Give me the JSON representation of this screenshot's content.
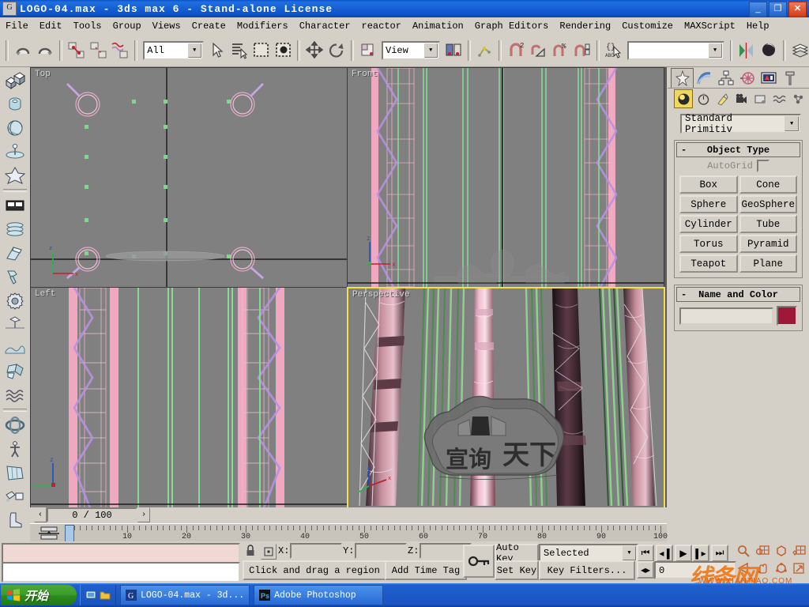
{
  "window": {
    "title": "LOGO-04.max - 3ds max 6 - Stand-alone License",
    "minimize_label": "_",
    "maximize_label": "❐",
    "close_label": "✕"
  },
  "menubar": {
    "items": [
      {
        "label": "File"
      },
      {
        "label": "Edit"
      },
      {
        "label": "Tools"
      },
      {
        "label": "Group"
      },
      {
        "label": "Views"
      },
      {
        "label": "Create"
      },
      {
        "label": "Modifiers"
      },
      {
        "label": "Character"
      },
      {
        "label": "reactor"
      },
      {
        "label": "Animation"
      },
      {
        "label": "Graph Editors"
      },
      {
        "label": "Rendering"
      },
      {
        "label": "Customize"
      },
      {
        "label": "MAXScript"
      },
      {
        "label": "Help"
      }
    ]
  },
  "toolbar": {
    "selection_filter": "All",
    "reference_coord": "View",
    "named_selection_set": "",
    "icons": [
      "undo-icon",
      "redo-icon",
      "select-and-link-icon",
      "unlink-selection-icon",
      "bind-to-space-warp-icon",
      "select-object-icon",
      "select-by-name-icon",
      "rectangular-selection-region-icon",
      "window-crossing-icon",
      "select-and-move-icon",
      "select-and-rotate-icon",
      "select-and-scale-icon",
      "use-pivot-point-center-icon",
      "mirror-icon",
      "align-icon",
      "snap-toggle-icon",
      "angle-snap-toggle-icon",
      "percent-snap-toggle-icon",
      "spinner-snap-toggle-icon",
      "named-selection-sets-icon",
      "render-scene-icon",
      "quick-render-icon",
      "layer-manager-icon"
    ]
  },
  "left_toolbar": {
    "icons": [
      "geometry-boxes-icon",
      "capsule-icon",
      "sphere-ball-icon",
      "turntable-icon",
      "star-figure-icon",
      "box-panel-icon",
      "coil-stack-icon",
      "wedge-icon",
      "hammer-icon",
      "gear-icon",
      "weathervane-icon",
      "landscape-icon",
      "shatter-icon",
      "waves-icon",
      "torus-knot-icon",
      "biped-icon",
      "cloth-panel-icon",
      "paint-bucket-icon",
      "boot-icon"
    ]
  },
  "viewports": [
    {
      "name": "Top",
      "label": "Top",
      "active": false
    },
    {
      "name": "Front",
      "label": "Front",
      "active": false
    },
    {
      "name": "Left",
      "label": "Left",
      "active": false
    },
    {
      "name": "Perspective",
      "label": "Perspective",
      "active": true
    }
  ],
  "command_panel": {
    "tabs": [
      {
        "name": "create",
        "icon": "create-star-icon",
        "selected": true
      },
      {
        "name": "modify",
        "icon": "modify-arc-icon",
        "selected": false
      },
      {
        "name": "hierarchy",
        "icon": "hierarchy-tree-icon",
        "selected": false
      },
      {
        "name": "motion",
        "icon": "motion-wheel-icon",
        "selected": false
      },
      {
        "name": "display",
        "icon": "display-monitor-icon",
        "selected": false
      },
      {
        "name": "utilities",
        "icon": "utilities-hammer-icon",
        "selected": false
      }
    ],
    "subtabs": [
      {
        "name": "geometry",
        "icon": "geometry-sphere-icon",
        "selected": true
      },
      {
        "name": "shapes",
        "icon": "shapes-icon",
        "selected": false
      },
      {
        "name": "lights",
        "icon": "lights-icon",
        "selected": false
      },
      {
        "name": "cameras",
        "icon": "camera-icon",
        "selected": false
      },
      {
        "name": "helpers",
        "icon": "helpers-icon",
        "selected": false
      },
      {
        "name": "space-warps",
        "icon": "space-warps-icon",
        "selected": false
      },
      {
        "name": "systems",
        "icon": "systems-icon",
        "selected": false
      }
    ],
    "category": "Standard Primitiv",
    "object_type": {
      "header": "Object Type",
      "collapse_glyph": "-",
      "autogrid_label": "AutoGrid",
      "autogrid_checked": false,
      "buttons": [
        "Box",
        "Cone",
        "Sphere",
        "GeoSphere",
        "Cylinder",
        "Tube",
        "Torus",
        "Pyramid",
        "Teapot",
        "Plane"
      ]
    },
    "name_and_color": {
      "header": "Name and Color",
      "collapse_glyph": "-",
      "name_value": "",
      "color_hex": "#a01838"
    }
  },
  "timeline": {
    "prev_frame_glyph": "‹",
    "next_frame_glyph": "›",
    "current_frame_display": "0 / 100",
    "ticks": [
      0,
      10,
      20,
      30,
      40,
      50,
      60,
      70,
      80,
      90,
      100
    ],
    "range_start": 0,
    "range_end": 100,
    "slider_position": 0
  },
  "status_bar": {
    "listener_value": "",
    "prompt_value": "",
    "lock_selection_icon": "lock-icon",
    "absolute_mode_icon": "absolute-relative-transform-icon",
    "coords": [
      {
        "label": "X:",
        "value": ""
      },
      {
        "label": "Y:",
        "value": ""
      },
      {
        "label": "Z:",
        "value": ""
      }
    ],
    "prompt_line": "Click and drag a region",
    "add_time_tag": "Add Time Tag",
    "key_mode_icon": "key-toggle-icon",
    "auto_key": "Auto Key",
    "set_key": "Set Key",
    "key_filter_target": "Selected",
    "key_filters": "Key Filters...",
    "playback_buttons": [
      {
        "name": "go-to-start",
        "glyph": "⏮"
      },
      {
        "name": "previous-frame",
        "glyph": "◂▐"
      },
      {
        "name": "play-animation",
        "glyph": "▶"
      },
      {
        "name": "next-frame",
        "glyph": "▌▸"
      },
      {
        "name": "go-to-end",
        "glyph": "⏭"
      }
    ],
    "key_mode_toggle_glyph": "◂▸",
    "current_frame_field": "0",
    "nav_icons": [
      "zoom-icon",
      "zoom-all-icon",
      "zoom-extents-icon",
      "zoom-extents-all-icon",
      "field-of-view-icon",
      "pan-icon",
      "arc-rotate-icon",
      "min-max-toggle-icon"
    ]
  },
  "taskbar": {
    "start_label": "开始",
    "quick_launch": [
      "show-desktop-icon",
      "folder-icon"
    ],
    "items": [
      {
        "label": "LOGO-04.max - 3d...",
        "icon": "3dsmax-icon"
      },
      {
        "label": "Adobe Photoshop",
        "icon": "photoshop-icon"
      }
    ]
  },
  "watermark": {
    "text": "线条网",
    "sub": "WWW.XIANTIAO.COM"
  }
}
